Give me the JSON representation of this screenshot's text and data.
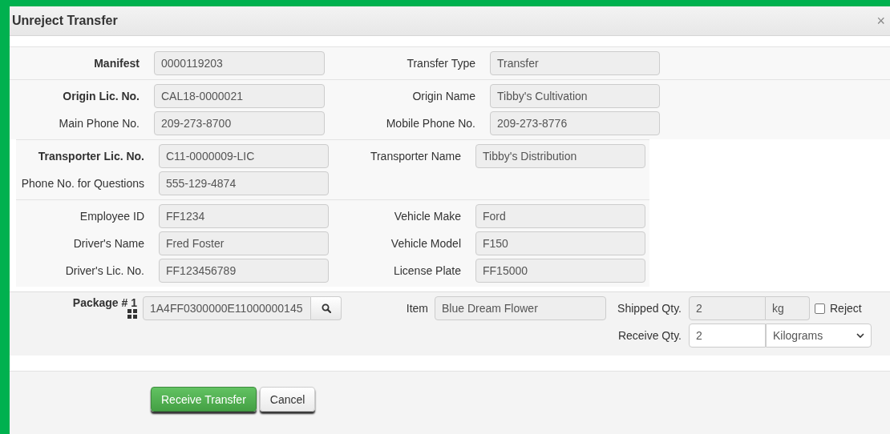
{
  "dialog": {
    "title": "Unreject Transfer",
    "close_label": "×"
  },
  "sections": [
    {
      "kind": "plain",
      "rows": [
        [
          {
            "label": "Manifest",
            "bold": true,
            "value": "0000119203"
          },
          {
            "label": "Transfer Type",
            "bold": false,
            "value": "Transfer"
          }
        ]
      ]
    },
    {
      "kind": "plain",
      "rows": [
        [
          {
            "label": "Origin Lic. No.",
            "bold": true,
            "value": "CAL18-0000021"
          },
          {
            "label": "Origin Name",
            "bold": false,
            "value": "Tibby's Cultivation"
          }
        ],
        [
          {
            "label": "Main Phone No.",
            "bold": false,
            "value": "209-273-8700"
          },
          {
            "label": "Mobile Phone No.",
            "bold": false,
            "value": "209-273-8776"
          }
        ]
      ]
    },
    {
      "kind": "inset",
      "rows": [
        [
          {
            "label": "Transporter Lic. No.",
            "bold": true,
            "value": "C11-0000009-LIC"
          },
          {
            "label": "Transporter Name",
            "bold": false,
            "value": "Tibby's Distribution"
          }
        ],
        [
          {
            "label": "Phone No. for Questions",
            "bold": false,
            "value": "555-129-4874"
          }
        ]
      ]
    },
    {
      "kind": "inset",
      "rows": [
        [
          {
            "label": "Employee ID",
            "bold": false,
            "value": "FF1234"
          },
          {
            "label": "Vehicle Make",
            "bold": false,
            "value": "Ford"
          }
        ],
        [
          {
            "label": "Driver's Name",
            "bold": false,
            "value": "Fred Foster"
          },
          {
            "label": "Vehicle Model",
            "bold": false,
            "value": "F150"
          }
        ],
        [
          {
            "label": "Driver's Lic. No.",
            "bold": false,
            "value": "FF123456789"
          },
          {
            "label": "License Plate",
            "bold": false,
            "value": "FF15000"
          }
        ]
      ]
    }
  ],
  "package": {
    "label": "Package # 1",
    "value": "1A4FF0300000E11000000145",
    "item_label": "Item",
    "item": "Blue Dream Flower",
    "shipped_label": "Shipped Qty.",
    "shipped_qty": "2",
    "shipped_unit": "kg",
    "reject": {
      "label": "Reject",
      "checked": false
    },
    "receive_label": "Receive Qty.",
    "receive_qty": "2",
    "receive_unit": "Kilograms"
  },
  "buttons": [
    {
      "label": "Receive Transfer",
      "kind": "primary"
    },
    {
      "label": "Cancel",
      "kind": "default"
    }
  ]
}
